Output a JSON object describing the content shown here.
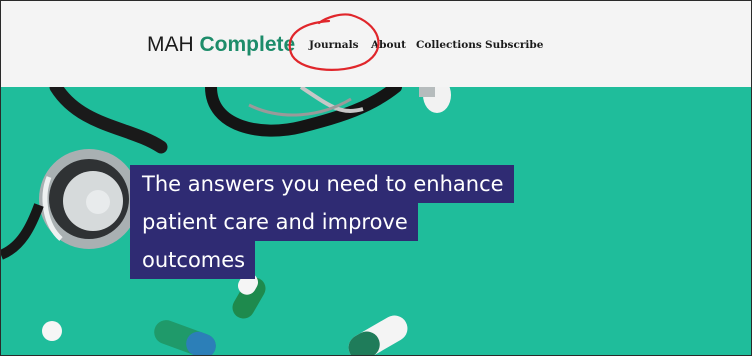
{
  "header": {
    "logo": {
      "prefix": "MAH",
      "accent": "Complete"
    },
    "nav": [
      {
        "label": "Journals"
      },
      {
        "label": "About"
      },
      {
        "label": "Collections"
      },
      {
        "label": "Subscribe"
      }
    ]
  },
  "hero": {
    "headline_lines": [
      "The answers you need to enhance",
      "patient care and improve",
      "outcomes"
    ]
  },
  "colors": {
    "accent": "#1d8c6a",
    "hero_bg": "#1fbd9b",
    "headline_bg": "#2f2b73",
    "annotation": "#e0262b"
  }
}
